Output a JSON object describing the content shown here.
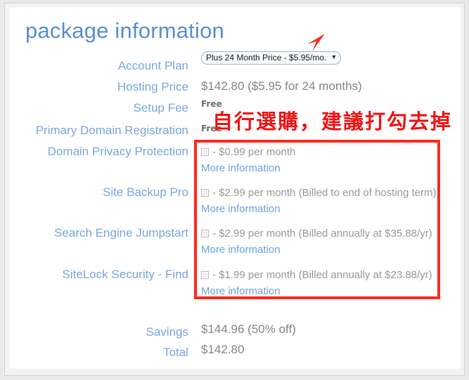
{
  "page_title": "package information",
  "annotation": {
    "cjk_note": "自行選購，建議打勾去掉",
    "arrow_color": "#fd2b1e",
    "box_color": "#fd2b1e"
  },
  "account_plan": {
    "label": "Account Plan",
    "selected_option": "Plus 24 Month Price - $5.95/mo.",
    "caret": "▼"
  },
  "summary_rows": [
    {
      "label": "Hosting Price",
      "value": "$142.80  ($5.95 for 24 months)"
    },
    {
      "label": "Setup Fee",
      "value": "Free"
    },
    {
      "label": "Primary Domain Registration",
      "value": "Free"
    }
  ],
  "addons": [
    {
      "label": "Domain Privacy Protection",
      "price_text": "- $0.99 per month",
      "link": "More information",
      "checked": false
    },
    {
      "label": "Site Backup Pro",
      "price_text": "- $2.99 per month (Billed to end of hosting term)",
      "link": "More information",
      "checked": false
    },
    {
      "label": "Search Engine Jumpstart",
      "price_text": "- $2.99 per month (Billed annually at $35.88/yr)",
      "link": "More information",
      "checked": false
    },
    {
      "label": "SiteLock Security - Find",
      "price_text": "- $1.99 per month (Billed annually at $23.88/yr)",
      "link": "More information",
      "checked": false
    }
  ],
  "totals": [
    {
      "label": "Savings",
      "value": "$144.96 (50% off)"
    },
    {
      "label": "Total",
      "value": "$142.80"
    }
  ],
  "colors": {
    "title_blue": "#5b8fd1",
    "label_blue": "#7aa8dd",
    "link_blue": "#6ea3e0",
    "value_grey": "#878787",
    "annotation_red": "#fd2b1e"
  }
}
